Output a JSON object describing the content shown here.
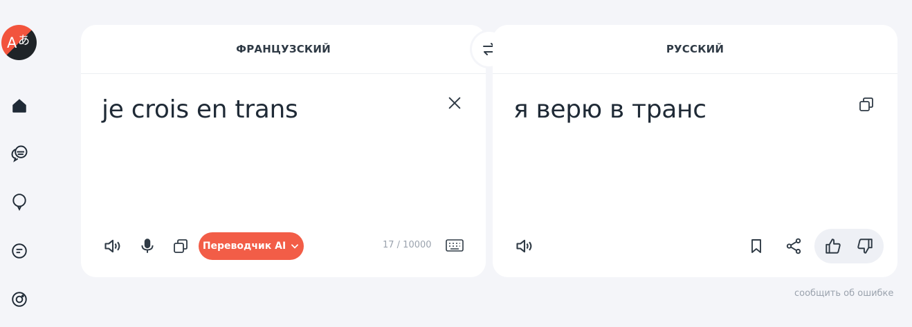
{
  "sidebar": {
    "logo_letter": "A",
    "logo_glyph": "あ",
    "items": [
      {
        "name": "home-icon"
      },
      {
        "name": "dialog-icon"
      },
      {
        "name": "speech-bubble-icon"
      },
      {
        "name": "document-icon"
      },
      {
        "name": "camera-icon"
      }
    ]
  },
  "source": {
    "language": "ФРАНЦУЗСКИЙ",
    "text": "je crois en trans",
    "counter": "17 / 10000",
    "ai_button_label": "Переводчик AI"
  },
  "target": {
    "language": "РУССКИЙ",
    "text": "я верю в транс"
  },
  "report_link": "сообщить об ошибке",
  "colors": {
    "accent": "#f25d47",
    "background": "#f4f5f9",
    "card": "#ffffff",
    "text": "#1f2a36",
    "muted": "#9aa2ad"
  }
}
